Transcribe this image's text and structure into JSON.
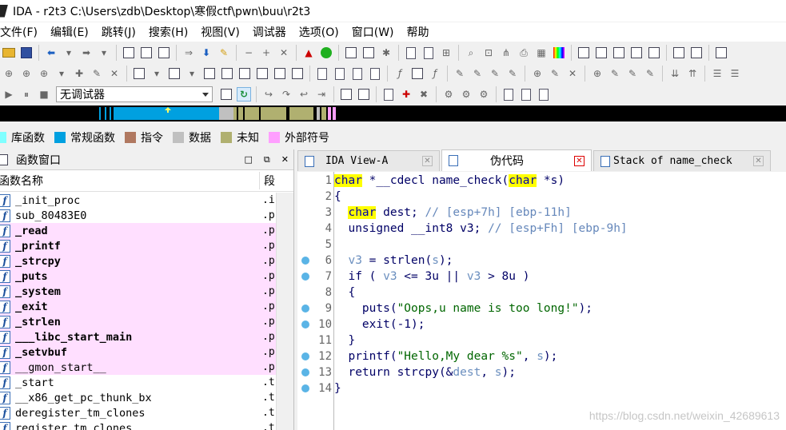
{
  "window": {
    "title": "IDA - r2t3 C:\\Users\\zdb\\Desktop\\寒假ctf\\pwn\\buu\\r2t3"
  },
  "menu": [
    "文件(F)",
    "编辑(E)",
    "跳转(J)",
    "搜索(H)",
    "视图(V)",
    "调试器",
    "选项(O)",
    "窗口(W)",
    "帮助"
  ],
  "toolbar": {
    "debugger_select": "无调试器"
  },
  "legend": [
    {
      "label": "库函数",
      "color": "#80ffff"
    },
    {
      "label": "常规函数",
      "color": "#00a0e0"
    },
    {
      "label": "指令",
      "color": "#b07860"
    },
    {
      "label": "数据",
      "color": "#c0c0c0"
    },
    {
      "label": "未知",
      "color": "#b0b070"
    },
    {
      "label": "外部符号",
      "color": "#ff9fff"
    }
  ],
  "functions_panel": {
    "title": "函数窗口",
    "col_name": "函数名称",
    "col_segment": "段",
    "rows": [
      {
        "name": "_init_proc",
        "seg": ".i",
        "extern": false,
        "bold": false
      },
      {
        "name": "sub_80483E0",
        "seg": ".p",
        "extern": false,
        "bold": false
      },
      {
        "name": "_read",
        "seg": ".p",
        "extern": true,
        "bold": true
      },
      {
        "name": "_printf",
        "seg": ".p",
        "extern": true,
        "bold": true
      },
      {
        "name": "_strcpy",
        "seg": ".p",
        "extern": true,
        "bold": true
      },
      {
        "name": "_puts",
        "seg": ".p",
        "extern": true,
        "bold": true
      },
      {
        "name": "_system",
        "seg": ".p",
        "extern": true,
        "bold": true
      },
      {
        "name": "_exit",
        "seg": ".p",
        "extern": true,
        "bold": true
      },
      {
        "name": "_strlen",
        "seg": ".p",
        "extern": true,
        "bold": true
      },
      {
        "name": "___libc_start_main",
        "seg": ".p",
        "extern": true,
        "bold": true
      },
      {
        "name": "_setvbuf",
        "seg": ".p",
        "extern": true,
        "bold": true
      },
      {
        "name": "__gmon_start__",
        "seg": ".p",
        "extern": true,
        "bold": false
      },
      {
        "name": "_start",
        "seg": ".t",
        "extern": false,
        "bold": false
      },
      {
        "name": "__x86_get_pc_thunk_bx",
        "seg": ".t",
        "extern": false,
        "bold": false
      },
      {
        "name": "deregister_tm_clones",
        "seg": ".t",
        "extern": false,
        "bold": false
      },
      {
        "name": "register_tm_clones",
        "seg": ".t",
        "extern": false,
        "bold": false
      }
    ]
  },
  "tabs": [
    {
      "label": "IDA View-A",
      "active": false
    },
    {
      "label": "伪代码",
      "active": true
    },
    {
      "label": "Stack of name_check",
      "active": false
    }
  ],
  "code": {
    "lines": [
      {
        "no": "1",
        "bp": false,
        "segs": [
          [
            "kw",
            "char"
          ],
          [
            "id",
            " *__cdecl name_check("
          ],
          [
            "kw",
            "char"
          ],
          [
            "id",
            " *s)"
          ]
        ]
      },
      {
        "no": "2",
        "bp": false,
        "segs": [
          [
            "id",
            "{"
          ]
        ]
      },
      {
        "no": "3",
        "bp": false,
        "segs": [
          [
            "id",
            "  "
          ],
          [
            "kw",
            "char"
          ],
          [
            "id",
            " dest; "
          ],
          [
            "cm",
            "// [esp+7h] [ebp-11h]"
          ]
        ]
      },
      {
        "no": "4",
        "bp": false,
        "segs": [
          [
            "id",
            "  unsigned __int8 v3; "
          ],
          [
            "cm",
            "// [esp+Fh] [ebp-9h]"
          ]
        ]
      },
      {
        "no": "5",
        "bp": false,
        "segs": [
          [
            "id",
            ""
          ]
        ]
      },
      {
        "no": "6",
        "bp": true,
        "segs": [
          [
            "id",
            "  "
          ],
          [
            "var",
            "v3"
          ],
          [
            "id",
            " = strlen("
          ],
          [
            "var",
            "s"
          ],
          [
            "id",
            ");"
          ]
        ]
      },
      {
        "no": "7",
        "bp": true,
        "segs": [
          [
            "id",
            "  if ( "
          ],
          [
            "var",
            "v3"
          ],
          [
            "id",
            " <= 3u || "
          ],
          [
            "var",
            "v3"
          ],
          [
            "id",
            " > 8u )"
          ]
        ]
      },
      {
        "no": "8",
        "bp": false,
        "segs": [
          [
            "id",
            "  {"
          ]
        ]
      },
      {
        "no": "9",
        "bp": true,
        "segs": [
          [
            "id",
            "    puts("
          ],
          [
            "str",
            "\"Oops,u name is too long!\""
          ],
          [
            "id",
            ");"
          ]
        ]
      },
      {
        "no": "10",
        "bp": true,
        "segs": [
          [
            "id",
            "    exit(-1);"
          ]
        ]
      },
      {
        "no": "11",
        "bp": false,
        "segs": [
          [
            "id",
            "  }"
          ]
        ]
      },
      {
        "no": "12",
        "bp": true,
        "segs": [
          [
            "id",
            "  printf("
          ],
          [
            "str",
            "\"Hello,My dear %s\""
          ],
          [
            "id",
            ", "
          ],
          [
            "var",
            "s"
          ],
          [
            "id",
            ");"
          ]
        ]
      },
      {
        "no": "13",
        "bp": true,
        "segs": [
          [
            "id",
            "  return strcpy(&"
          ],
          [
            "var",
            "dest"
          ],
          [
            "id",
            ", "
          ],
          [
            "var",
            "s"
          ],
          [
            "id",
            ");"
          ]
        ]
      },
      {
        "no": "14",
        "bp": true,
        "segs": [
          [
            "id",
            "}"
          ]
        ]
      }
    ]
  },
  "watermark": "https://blog.csdn.net/weixin_42689613"
}
